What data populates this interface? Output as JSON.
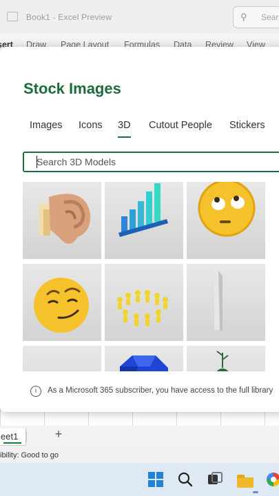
{
  "titlebar": {
    "title": "Book1 - Excel Preview",
    "search_placeholder": "Sear"
  },
  "ribbon": {
    "tabs": [
      "sert",
      "Draw",
      "Page Layout",
      "Formulas",
      "Data",
      "Review",
      "View"
    ]
  },
  "dialog": {
    "title": "Stock Images",
    "tabs": [
      {
        "label": "Images",
        "active": false
      },
      {
        "label": "Icons",
        "active": false
      },
      {
        "label": "3D",
        "active": true
      },
      {
        "label": "Cutout People",
        "active": false
      },
      {
        "label": "Stickers",
        "active": false
      }
    ],
    "search": {
      "placeholder": "Search 3D Models",
      "value": ""
    },
    "tiles": [
      {
        "name": "ear-model",
        "row": 1,
        "col": 1
      },
      {
        "name": "bar-chart-model",
        "row": 1,
        "col": 2
      },
      {
        "name": "eye-roll-emoji-model",
        "row": 1,
        "col": 3
      },
      {
        "name": "smirk-emoji-model",
        "row": 2,
        "col": 1
      },
      {
        "name": "people-circle-model",
        "row": 2,
        "col": 2
      },
      {
        "name": "obelisk-model",
        "row": 2,
        "col": 3
      },
      {
        "name": "blank-model",
        "row": 3,
        "col": 1
      },
      {
        "name": "blue-gem-model",
        "row": 3,
        "col": 2
      },
      {
        "name": "plant-pot-model",
        "row": 3,
        "col": 3
      }
    ],
    "footer_text": "As a Microsoft 365 subscriber, you have access to the full library"
  },
  "sheet": {
    "tab_label": "eet1",
    "add_label": "+"
  },
  "status": {
    "text": "ibility: Good to go"
  },
  "taskbar": {
    "icons": [
      "windows-icon",
      "search-icon",
      "task-view-icon",
      "file-explorer-icon",
      "chrome-icon"
    ]
  },
  "colors": {
    "accent": "#1d6b3c",
    "excel_green": "#107c41"
  }
}
